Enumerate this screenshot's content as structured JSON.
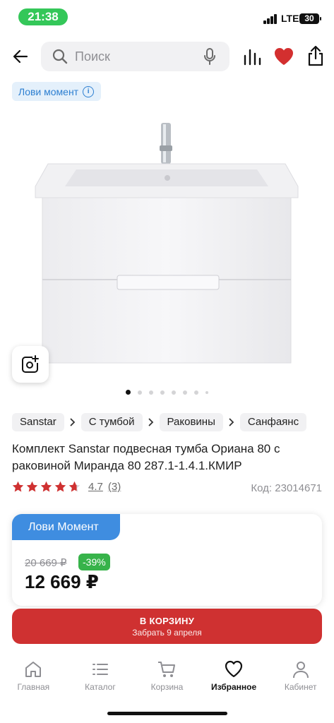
{
  "status_bar": {
    "time": "21:38",
    "network": "LTE",
    "battery": "30"
  },
  "search": {
    "placeholder": "Поиск"
  },
  "icons": {
    "back": "arrow-left-icon",
    "search": "search-icon",
    "mic": "microphone-icon",
    "compare": "compare-bars-icon",
    "favorite": "heart-icon",
    "share": "share-icon",
    "photo_search": "photo-search-icon",
    "info": "info-icon"
  },
  "promo_chip": {
    "label": "Лови момент",
    "info_glyph": "i"
  },
  "gallery": {
    "total_slides": 8,
    "active_index": 0
  },
  "breadcrumbs": [
    "Sanstar",
    "С тумбой",
    "Раковины",
    "Санфаянс"
  ],
  "product": {
    "title": "Комплект Sanstar подвесная тумба Ориана 80 с раковиной Миранда 80 287.1-1.4.1.КМИР",
    "rating_value": "4.7",
    "rating_count": "(3)",
    "stars_filled": 4.7,
    "code": "Код: 23014671"
  },
  "price": {
    "banner": "Лови Момент",
    "old_price": "20 669 ₽",
    "discount": "-39%",
    "new_price": "12 669 ₽"
  },
  "cart_button": {
    "label": "В КОРЗИНУ",
    "sub": "Забрать 9 апреля"
  },
  "bottom_nav": [
    {
      "label": "Главная",
      "icon": "home-icon"
    },
    {
      "label": "Каталог",
      "icon": "catalog-icon"
    },
    {
      "label": "Корзина",
      "icon": "cart-icon"
    },
    {
      "label": "Избранное",
      "icon": "heart-icon"
    },
    {
      "label": "Кабинет",
      "icon": "profile-icon"
    }
  ],
  "colors": {
    "accent_red": "#cf3131",
    "heart_red": "#d32f2f",
    "promo_blue": "#3f8de0",
    "discount_green": "#37b34a",
    "status_green": "#34c759"
  }
}
